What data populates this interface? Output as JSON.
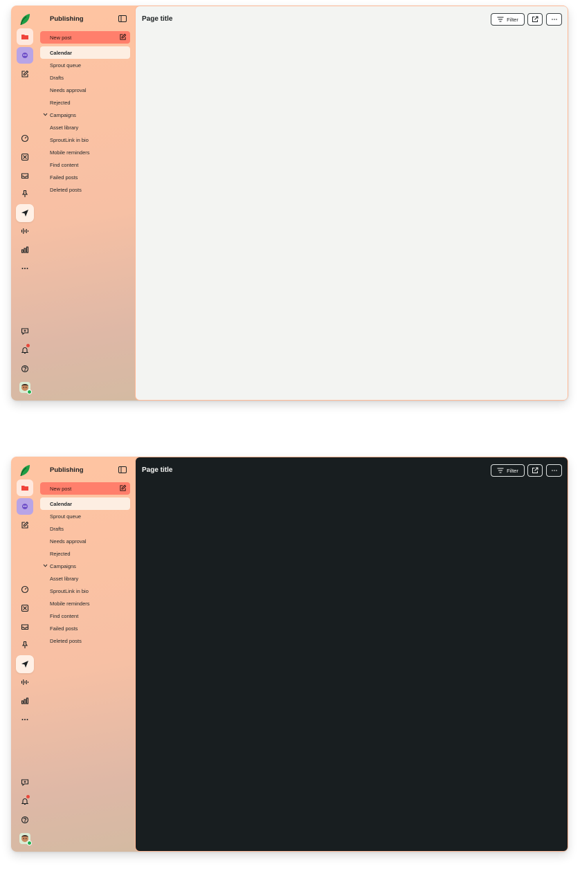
{
  "rail": {
    "icons": [
      "sprout-logo",
      "folder-icon",
      "bot-icon",
      "compose-icon",
      "gauge-icon",
      "smart-inbox-icon",
      "inbox-icon",
      "pin-icon",
      "send-icon",
      "listening-icon",
      "bar-chart-icon",
      "more-icon",
      "feedback-icon",
      "bell-icon",
      "help-icon",
      "avatar"
    ],
    "active": "send-icon",
    "notification_badge_color": "#e8483b",
    "online_status_color": "#21b04c"
  },
  "nav": {
    "title": "Publishing",
    "new_post_label": "New post",
    "new_post_color": "#ff7f6c",
    "items": [
      {
        "label": "Calendar",
        "selected": true
      },
      {
        "label": "Sprout queue"
      },
      {
        "label": "Drafts"
      },
      {
        "label": "Needs approval"
      },
      {
        "label": "Rejected"
      },
      {
        "label": "Campaigns",
        "expandable": true
      },
      {
        "label": "Asset library"
      },
      {
        "label": "SproutLink in bio"
      },
      {
        "label": "Mobile reminders"
      },
      {
        "label": "Find content"
      },
      {
        "label": "Failed posts"
      },
      {
        "label": "Deleted posts"
      }
    ]
  },
  "main": {
    "page_title": "Page title",
    "filter_label": "Filter"
  },
  "themes": {
    "light": {
      "content_bg": "#f3f4f2"
    },
    "dark": {
      "content_bg": "#181e20"
    }
  }
}
